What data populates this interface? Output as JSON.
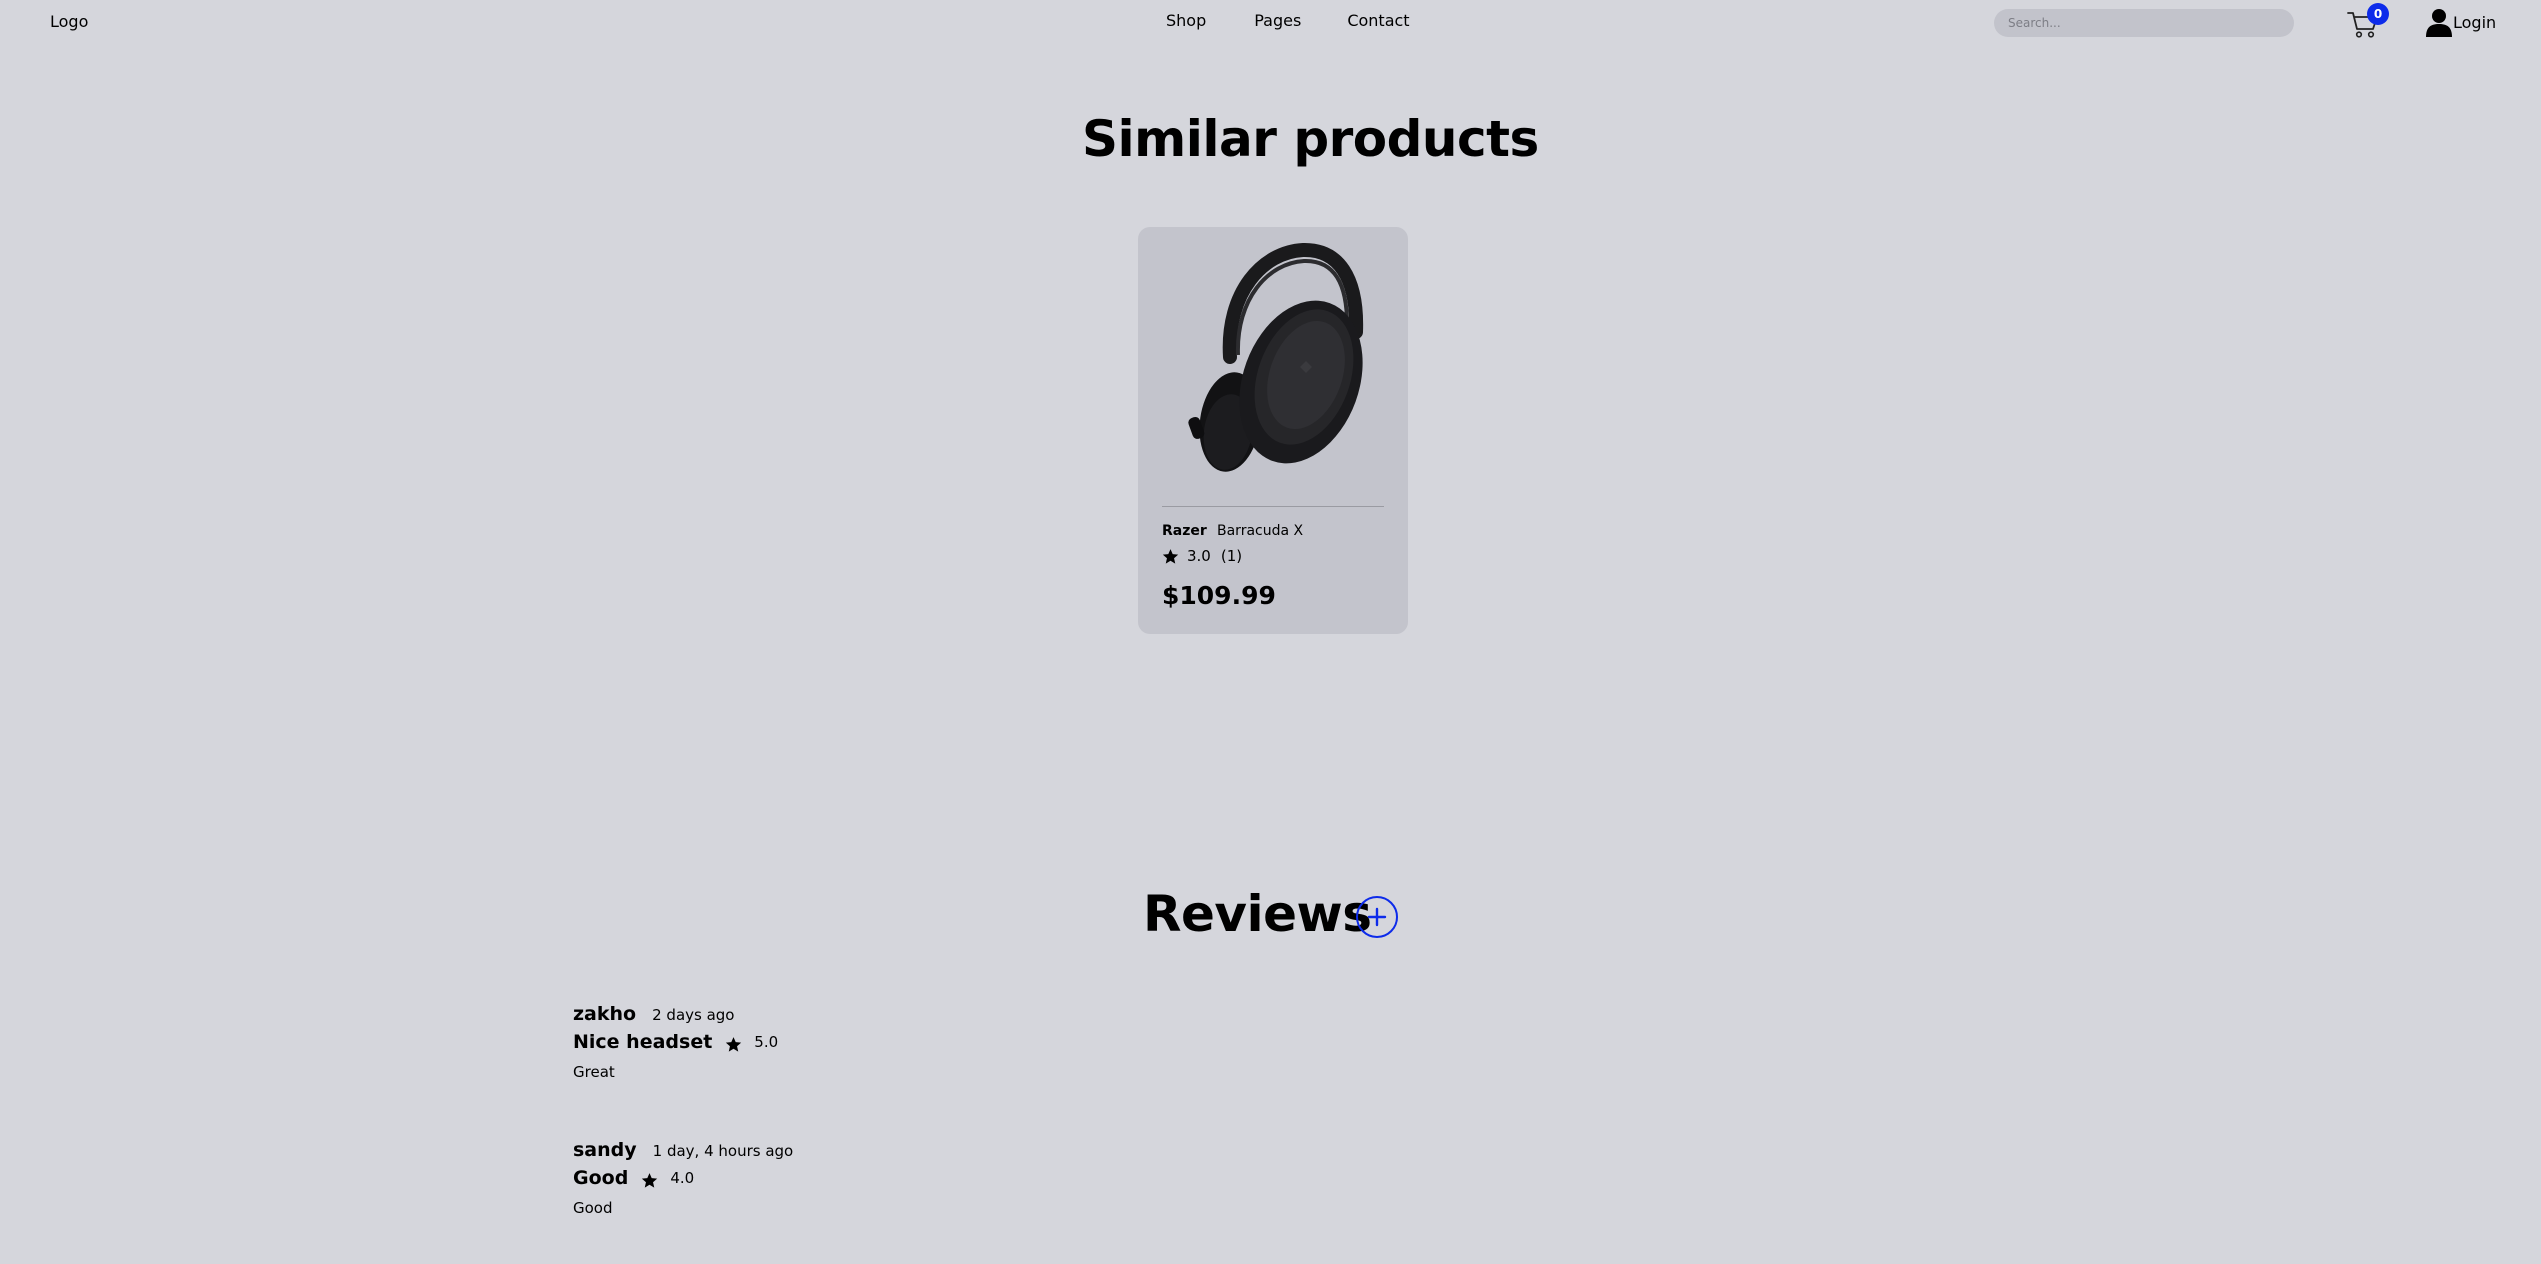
{
  "navbar": {
    "logo": "Logo",
    "links": [
      "Shop",
      "Pages",
      "Contact"
    ],
    "search_placeholder": "Search...",
    "cart_count": "0",
    "login_label": "Login"
  },
  "similar": {
    "title": "Similar products",
    "products": [
      {
        "brand": "Razer",
        "model": "Barracuda X",
        "rating": "3.0",
        "rating_count": "(1)",
        "price": "$109.99"
      }
    ]
  },
  "reviews": {
    "title": "Reviews",
    "items": [
      {
        "author": "zakho",
        "time": "2 days ago",
        "title": "Nice headset",
        "rating": "5.0",
        "body": "Great"
      },
      {
        "author": "sandy",
        "time": "1 day, 4 hours ago",
        "title": "Good",
        "rating": "4.0",
        "body": "Good"
      }
    ]
  },
  "colors": {
    "background": "#d5d6dc",
    "card": "#c3c4cc",
    "accent": "#0d2bea",
    "search_bg": "#c2c3cb"
  },
  "icons": {
    "cart": "cart-icon",
    "user": "user-icon",
    "star": "star-icon",
    "plus": "plus-icon"
  }
}
